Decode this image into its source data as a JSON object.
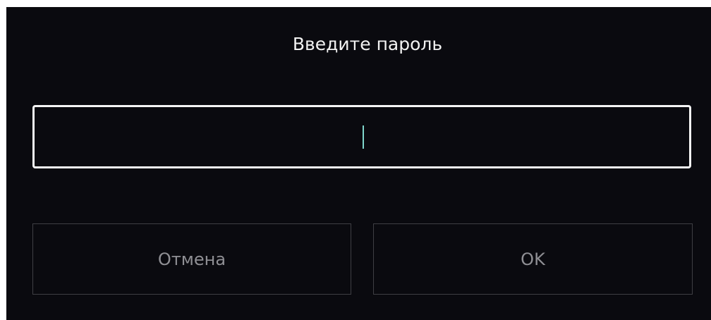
{
  "dialog": {
    "title": "Введите пароль",
    "password": {
      "value": "",
      "placeholder": ""
    },
    "buttons": {
      "cancel_label": "Отмена",
      "ok_label": "OK"
    }
  },
  "colors": {
    "background": "#0a0a0f",
    "text": "#f2f2f2",
    "field_border": "#f5f5f5",
    "cursor": "#7fd6cc",
    "button_border": "#3f3f44",
    "button_text": "#8f8f94"
  }
}
